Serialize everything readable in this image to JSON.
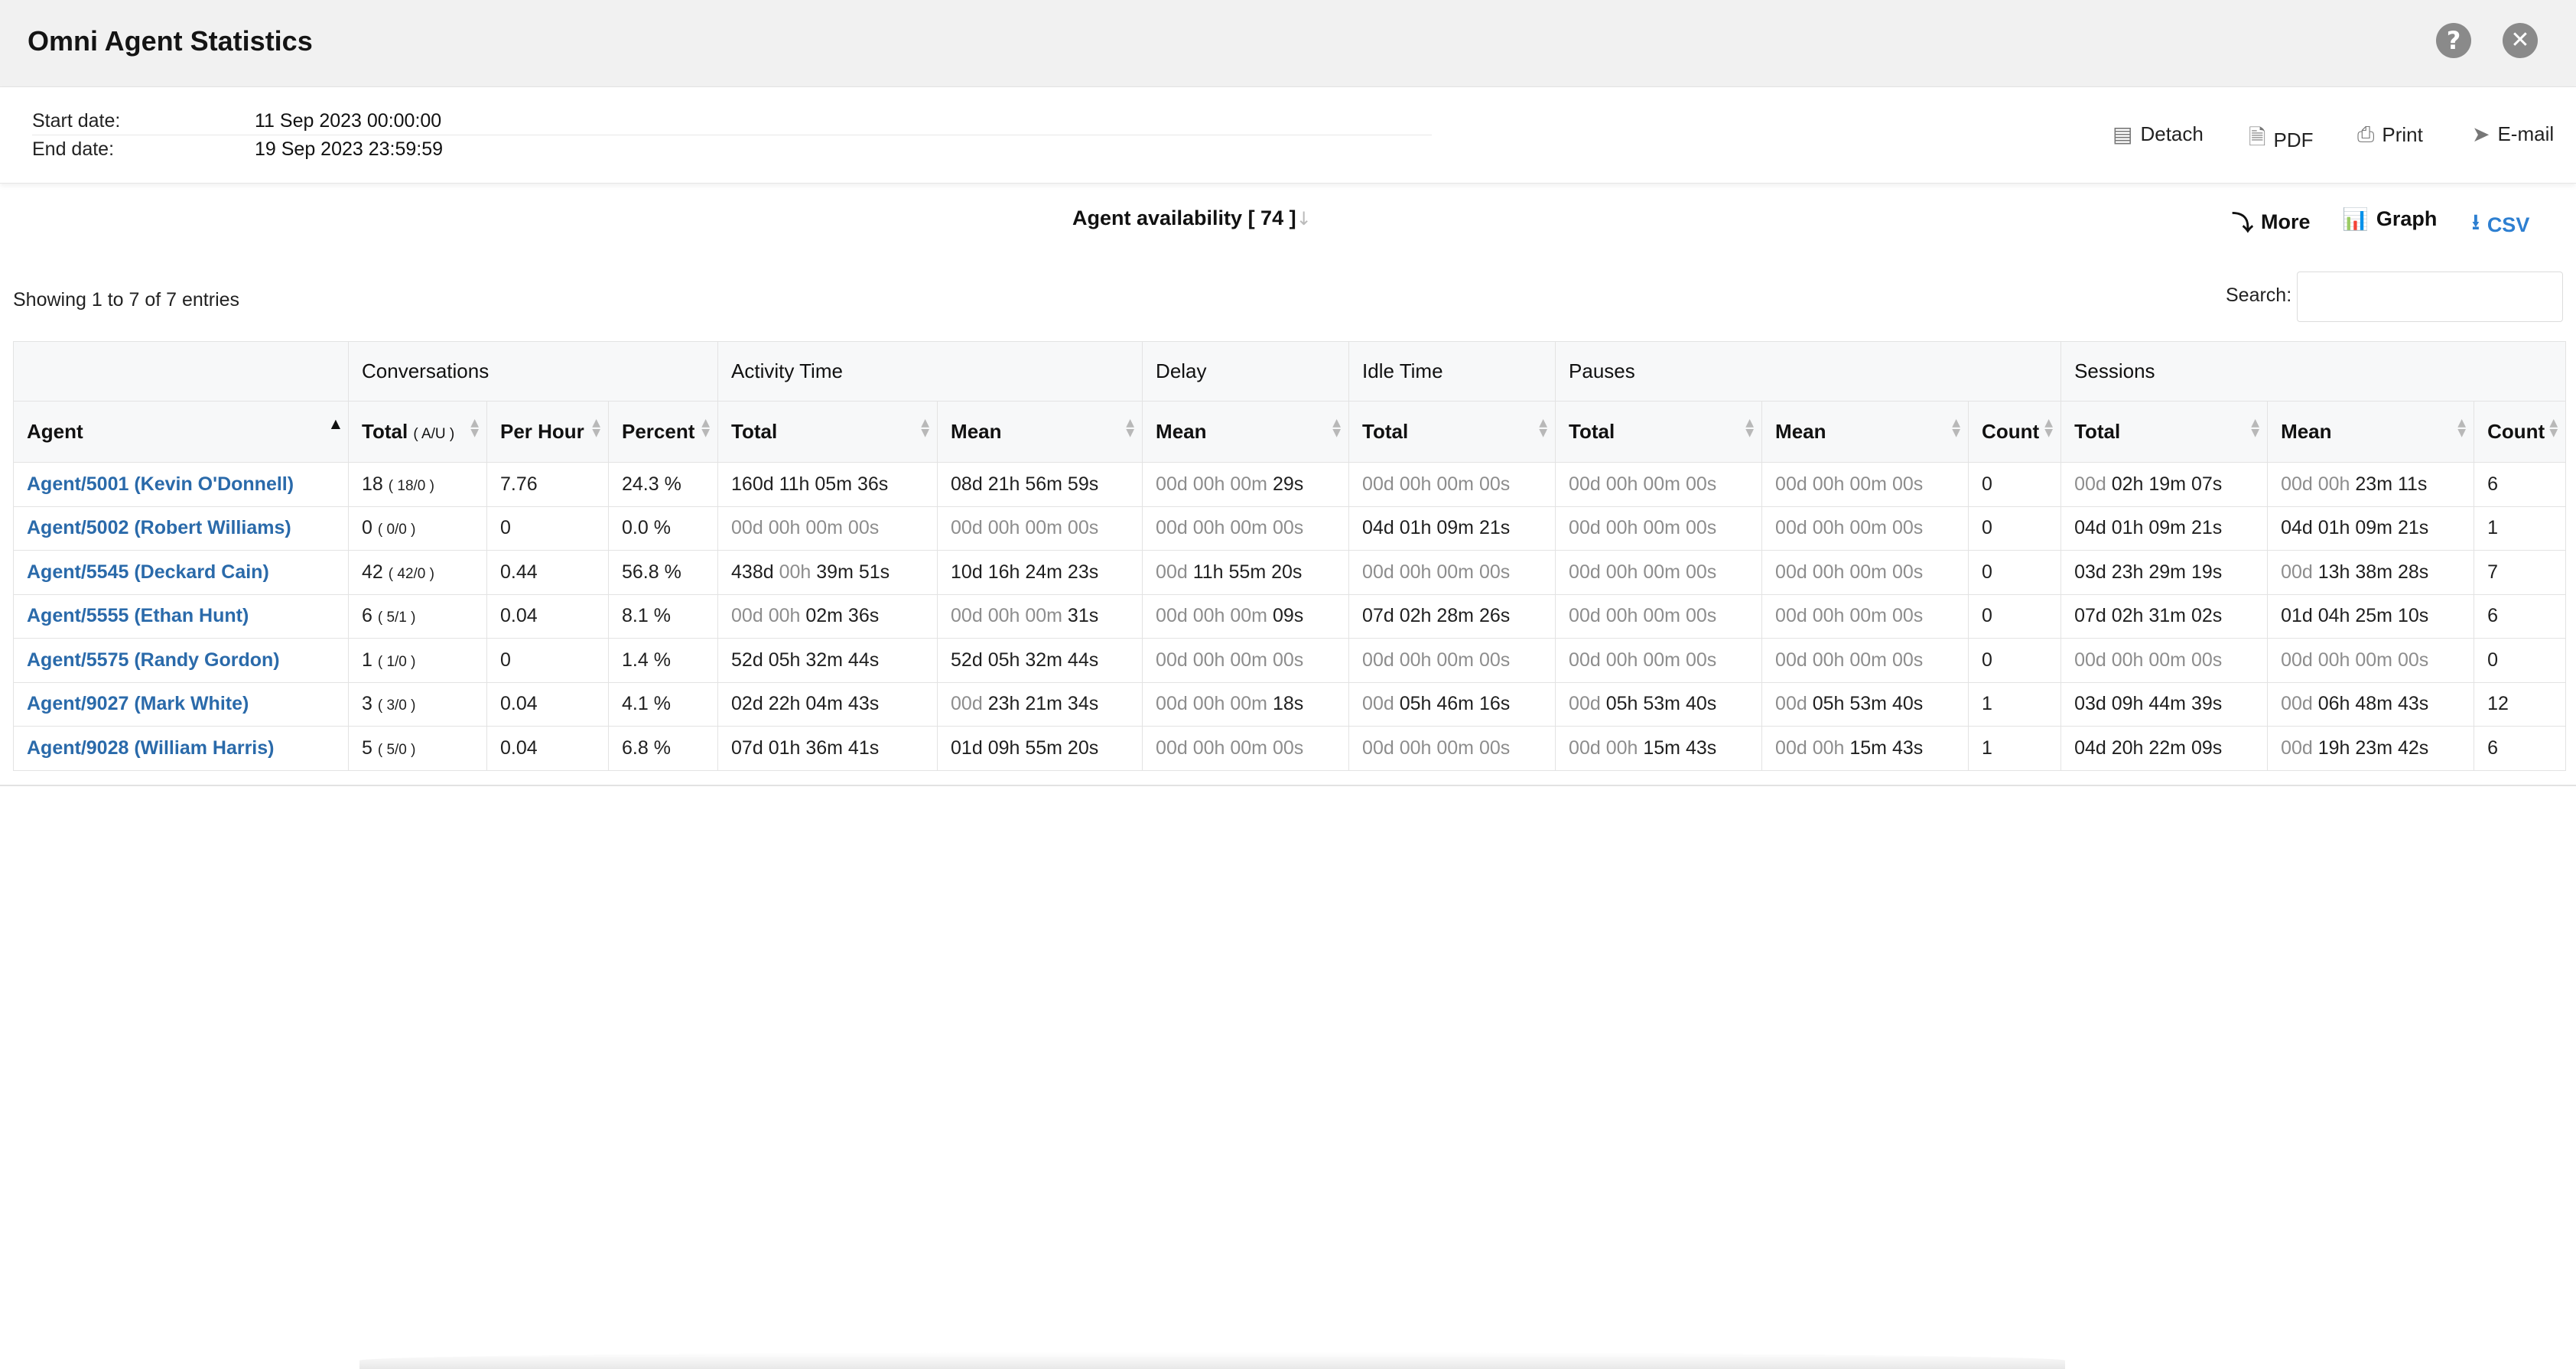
{
  "window": {
    "title": "Omni Agent Statistics",
    "help_icon": "help-icon",
    "close_icon": "close-icon"
  },
  "info": {
    "start_label": "Start date:",
    "start_value": "11 Sep 2023 00:00:00",
    "end_label": "End date:",
    "end_value": "19 Sep 2023 23:59:59"
  },
  "header_actions": {
    "detach": "Detach",
    "pdf": "PDF",
    "print": "Print",
    "email": "E-mail"
  },
  "report": {
    "title": "Agent availability [ 74 ]",
    "more": "More",
    "graph": "Graph",
    "csv": "CSV",
    "showing": "Showing 1 to 7 of 7 entries",
    "search_label": "Search:",
    "search_value": "",
    "accent_link": "#2a6aaa",
    "graph_icon_color": "#e2452f",
    "csv_color": "#2d7fd1"
  },
  "table": {
    "groups": [
      "",
      "Conversations",
      "Activity Time",
      "Delay",
      "Idle Time",
      "Pauses",
      "Sessions"
    ],
    "columns": {
      "agent": "Agent",
      "conv_total": "Total",
      "conv_total_sub": "( A/U )",
      "per_hour": "Per Hour",
      "percent": "Percent",
      "act_total": "Total",
      "act_mean": "Mean",
      "delay_mean": "Mean",
      "idle_total": "Total",
      "pause_total": "Total",
      "pause_mean": "Mean",
      "pause_count": "Count",
      "sess_total": "Total",
      "sess_mean": "Mean",
      "sess_count": "Count"
    },
    "rows": [
      {
        "agent": "Agent/5001 (Kevin O'Donnell)",
        "conv_total": "18",
        "conv_au": "( 18/0 )",
        "per_hour": "7.76",
        "percent": "24.3 %",
        "act_total": {
          "muted": "",
          "value": "160d 11h 05m 36s"
        },
        "act_mean": {
          "muted": "",
          "value": "08d 21h 56m 59s"
        },
        "delay_mean": {
          "muted": "00d 00h 00m",
          "value": " 29s"
        },
        "idle_total": {
          "muted": "00d 00h 00m 00s",
          "value": ""
        },
        "pause_total": {
          "muted": "00d 00h 00m 00s",
          "value": ""
        },
        "pause_mean": {
          "muted": "00d 00h 00m 00s",
          "value": ""
        },
        "pause_count": "0",
        "sess_total": {
          "muted": "00d",
          "value": " 02h 19m 07s"
        },
        "sess_mean": {
          "muted": "00d 00h",
          "value": " 23m 11s"
        },
        "sess_count": "6"
      },
      {
        "agent": "Agent/5002 (Robert Williams)",
        "conv_total": "0",
        "conv_au": "( 0/0 )",
        "per_hour": "0",
        "percent": "0.0 %",
        "act_total": {
          "muted": "00d 00h 00m 00s",
          "value": ""
        },
        "act_mean": {
          "muted": "00d 00h 00m 00s",
          "value": ""
        },
        "delay_mean": {
          "muted": "00d 00h 00m 00s",
          "value": ""
        },
        "idle_total": {
          "muted": "",
          "value": "04d 01h 09m 21s"
        },
        "pause_total": {
          "muted": "00d 00h 00m 00s",
          "value": ""
        },
        "pause_mean": {
          "muted": "00d 00h 00m 00s",
          "value": ""
        },
        "pause_count": "0",
        "sess_total": {
          "muted": "",
          "value": "04d 01h 09m 21s"
        },
        "sess_mean": {
          "muted": "",
          "value": "04d 01h 09m 21s"
        },
        "sess_count": "1"
      },
      {
        "agent": "Agent/5545 (Deckard Cain)",
        "conv_total": "42",
        "conv_au": "( 42/0 )",
        "per_hour": "0.44",
        "percent": "56.8 %",
        "act_total": {
          "muted": "",
          "value": "438d",
          "muted2": " 00h",
          "value2": " 39m 51s"
        },
        "act_mean": {
          "muted": "",
          "value": "10d 16h 24m 23s"
        },
        "delay_mean": {
          "muted": "00d",
          "value": " 11h 55m 20s"
        },
        "idle_total": {
          "muted": "00d 00h 00m 00s",
          "value": ""
        },
        "pause_total": {
          "muted": "00d 00h 00m 00s",
          "value": ""
        },
        "pause_mean": {
          "muted": "00d 00h 00m 00s",
          "value": ""
        },
        "pause_count": "0",
        "sess_total": {
          "muted": "",
          "value": "03d 23h 29m 19s"
        },
        "sess_mean": {
          "muted": "00d",
          "value": " 13h 38m 28s"
        },
        "sess_count": "7"
      },
      {
        "agent": "Agent/5555 (Ethan Hunt)",
        "conv_total": "6",
        "conv_au": "( 5/1 )",
        "per_hour": "0.04",
        "percent": "8.1 %",
        "act_total": {
          "muted": "00d 00h",
          "value": " 02m 36s"
        },
        "act_mean": {
          "muted": "00d 00h 00m",
          "value": " 31s"
        },
        "delay_mean": {
          "muted": "00d 00h 00m",
          "value": " 09s"
        },
        "idle_total": {
          "muted": "",
          "value": "07d 02h 28m 26s"
        },
        "pause_total": {
          "muted": "00d 00h 00m 00s",
          "value": ""
        },
        "pause_mean": {
          "muted": "00d 00h 00m 00s",
          "value": ""
        },
        "pause_count": "0",
        "sess_total": {
          "muted": "",
          "value": "07d 02h 31m 02s"
        },
        "sess_mean": {
          "muted": "",
          "value": "01d 04h 25m 10s"
        },
        "sess_count": "6"
      },
      {
        "agent": "Agent/5575 (Randy Gordon)",
        "conv_total": "1",
        "conv_au": "( 1/0 )",
        "per_hour": "0",
        "percent": "1.4 %",
        "act_total": {
          "muted": "",
          "value": "52d 05h 32m 44s"
        },
        "act_mean": {
          "muted": "",
          "value": "52d 05h 32m 44s"
        },
        "delay_mean": {
          "muted": "00d 00h 00m 00s",
          "value": ""
        },
        "idle_total": {
          "muted": "00d 00h 00m 00s",
          "value": ""
        },
        "pause_total": {
          "muted": "00d 00h 00m 00s",
          "value": ""
        },
        "pause_mean": {
          "muted": "00d 00h 00m 00s",
          "value": ""
        },
        "pause_count": "0",
        "sess_total": {
          "muted": "00d 00h 00m 00s",
          "value": ""
        },
        "sess_mean": {
          "muted": "00d 00h 00m 00s",
          "value": ""
        },
        "sess_count": "0"
      },
      {
        "agent": "Agent/9027 (Mark White)",
        "conv_total": "3",
        "conv_au": "( 3/0 )",
        "per_hour": "0.04",
        "percent": "4.1 %",
        "act_total": {
          "muted": "",
          "value": "02d 22h 04m 43s"
        },
        "act_mean": {
          "muted": "00d",
          "value": " 23h 21m 34s"
        },
        "delay_mean": {
          "muted": "00d 00h 00m",
          "value": " 18s"
        },
        "idle_total": {
          "muted": "00d",
          "value": " 05h 46m 16s"
        },
        "pause_total": {
          "muted": "00d",
          "value": " 05h 53m 40s"
        },
        "pause_mean": {
          "muted": "00d",
          "value": " 05h 53m 40s"
        },
        "pause_count": "1",
        "sess_total": {
          "muted": "",
          "value": "03d 09h 44m 39s"
        },
        "sess_mean": {
          "muted": "00d",
          "value": " 06h 48m 43s"
        },
        "sess_count": "12"
      },
      {
        "agent": "Agent/9028 (William Harris)",
        "conv_total": "5",
        "conv_au": "( 5/0 )",
        "per_hour": "0.04",
        "percent": "6.8 %",
        "act_total": {
          "muted": "",
          "value": "07d 01h 36m 41s"
        },
        "act_mean": {
          "muted": "",
          "value": "01d 09h 55m 20s"
        },
        "delay_mean": {
          "muted": "00d 00h 00m 00s",
          "value": ""
        },
        "idle_total": {
          "muted": "00d 00h 00m 00s",
          "value": ""
        },
        "pause_total": {
          "muted": "00d 00h",
          "value": " 15m 43s"
        },
        "pause_mean": {
          "muted": "00d 00h",
          "value": " 15m 43s"
        },
        "pause_count": "1",
        "sess_total": {
          "muted": "",
          "value": "04d 20h 22m 09s"
        },
        "sess_mean": {
          "muted": "00d",
          "value": " 19h 23m 42s"
        },
        "sess_count": "6"
      }
    ]
  }
}
